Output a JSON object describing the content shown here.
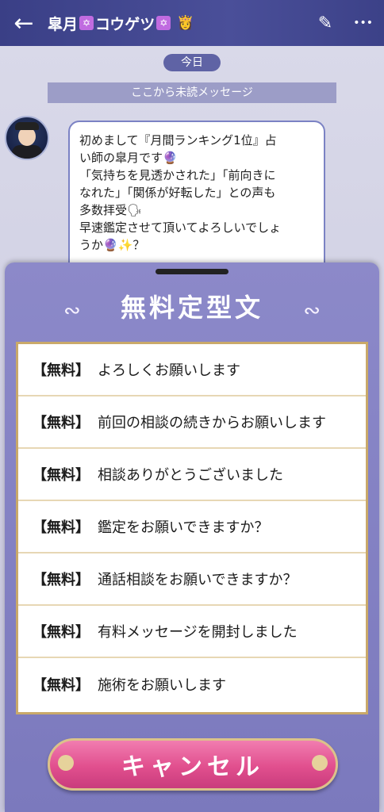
{
  "header": {
    "back_glyph": "←",
    "title": "皐月",
    "title2": "コウゲツ",
    "edit_glyph": "✎",
    "more_glyph": "•••"
  },
  "chat": {
    "date_chip": "今日",
    "unread_divider": "ここから未読メッセージ",
    "message": "初めまして『月間ランキング1位』占\nい師の皐月です🔮\n「気持ちを見透かされた」「前向きに\nなれた」「関係が好転した」との声も\n多数拝受🗣\n早速鑑定させて頂いてよろしいでしょ\nうか🔮✨？\n\n【初回限定】"
  },
  "sheet": {
    "title": "無料定型文",
    "items": [
      {
        "tag": "【無料】",
        "text": "よろしくお願いします"
      },
      {
        "tag": "【無料】",
        "text": "前回の相談の続きからお願いします"
      },
      {
        "tag": "【無料】",
        "text": "相談ありがとうございました"
      },
      {
        "tag": "【無料】",
        "text": "鑑定をお願いできますか？"
      },
      {
        "tag": "【無料】",
        "text": "通話相談をお願いできますか？"
      },
      {
        "tag": "【無料】",
        "text": "有料メッセージを開封しました"
      },
      {
        "tag": "【無料】",
        "text": "施術をお願いします"
      }
    ],
    "cancel_label": "キャンセル"
  }
}
